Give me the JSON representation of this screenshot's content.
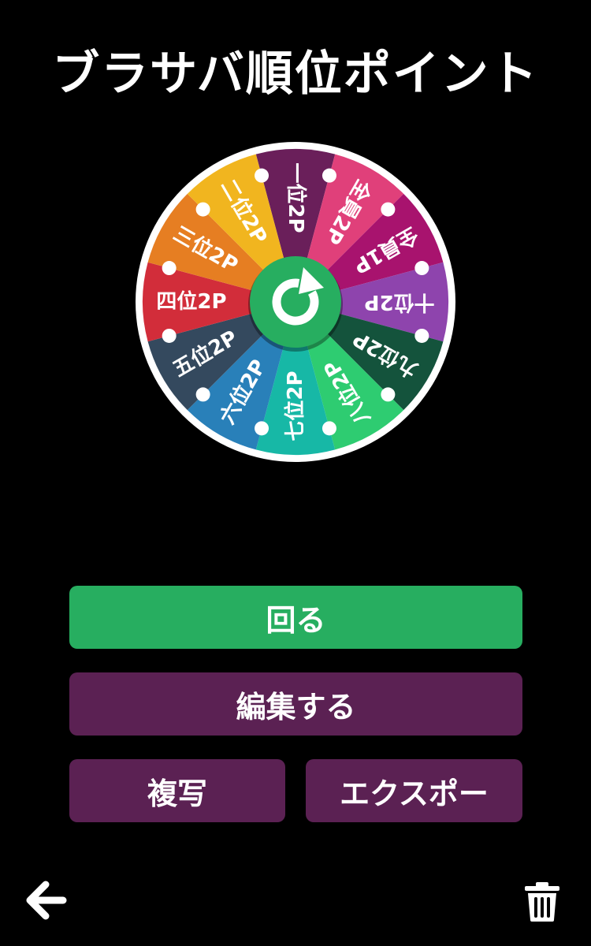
{
  "app": {
    "title": "ブラサバ順位ポイント"
  },
  "wheel": {
    "segments": [
      {
        "label": "一位2P",
        "color": "#6a1f5a"
      },
      {
        "label": "全員2P",
        "color": "#e0407a"
      },
      {
        "label": "全員1P",
        "color": "#a8136e"
      },
      {
        "label": "十位2P",
        "color": "#8e44ad"
      },
      {
        "label": "九位2P",
        "color": "#14533c"
      },
      {
        "label": "八位2P",
        "color": "#2ecc71"
      },
      {
        "label": "七位2P",
        "color": "#17b8a6"
      },
      {
        "label": "六位2P",
        "color": "#2980b9"
      },
      {
        "label": "五位2P",
        "color": "#34495e"
      },
      {
        "label": "四位2P",
        "color": "#d22d3a"
      },
      {
        "label": "三位2P",
        "color": "#e67e22"
      },
      {
        "label": "二位2P",
        "color": "#f1b51f"
      }
    ],
    "spin_icon": "refresh-icon",
    "center_color": "#27ae60",
    "rim_color": "#ffffff"
  },
  "buttons": {
    "spin": "回る",
    "edit": "編集する",
    "copy": "複写",
    "export": "エクスポー"
  },
  "colors": {
    "spin_button": "#27ae60",
    "secondary_button": "#5b2153",
    "background": "#000000"
  },
  "nav": {
    "back_icon": "arrow-left-icon",
    "delete_icon": "trash-icon"
  }
}
